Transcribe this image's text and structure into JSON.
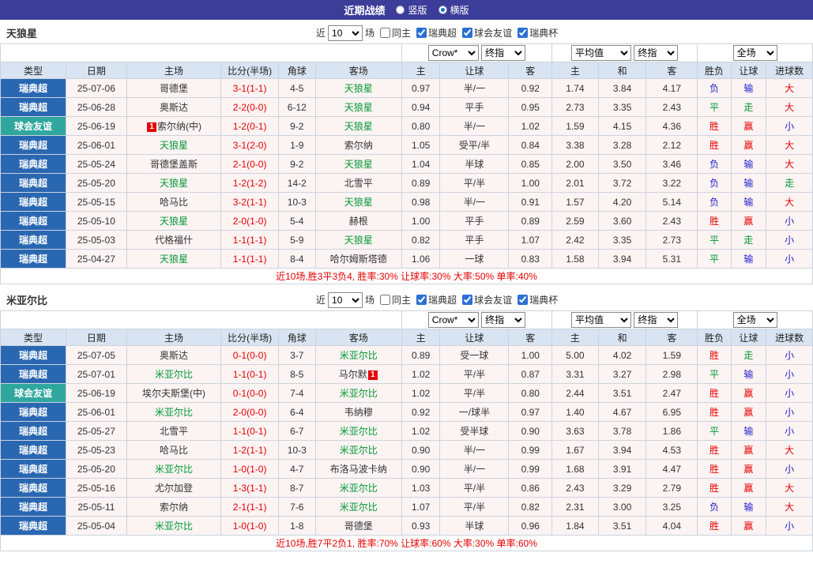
{
  "topbar": {
    "title": "近期战绩",
    "options": [
      {
        "label": "竖版",
        "selected": false
      },
      {
        "label": "横版",
        "selected": true
      }
    ]
  },
  "colors": {
    "league_badge": "#2a67b1",
    "friendly_badge": "#2fa79f",
    "win_red": "#e60000",
    "draw_green": "#009933",
    "loss_blue": "#2222cc"
  },
  "sections": [
    {
      "team": "天狼星",
      "filter": {
        "near_label": "近",
        "count": "10",
        "games_label": "场",
        "checkboxes": [
          {
            "label": "同主",
            "checked": false
          },
          {
            "label": "瑞典超",
            "checked": true
          },
          {
            "label": "球会友谊",
            "checked": true
          },
          {
            "label": "瑞典杯",
            "checked": true
          }
        ]
      },
      "selects": {
        "bookmaker": "Crow*",
        "bookmaker_stage": "终指",
        "euro": "平均值",
        "euro_stage": "终指",
        "scope": "全场"
      },
      "columns": [
        "类型",
        "日期",
        "主场",
        "比分(半场)",
        "角球",
        "客场",
        "主",
        "让球",
        "客",
        "主",
        "和",
        "客",
        "胜负",
        "让球",
        "进球数"
      ],
      "rows": [
        {
          "type": "瑞典超",
          "date": "25-07-06",
          "home": {
            "name": "哥德堡"
          },
          "score": "3-1(1-1)",
          "corner": "4-5",
          "away": {
            "name": "天狼星",
            "focus": true
          },
          "asia": [
            "0.97",
            "半/一",
            "0.92"
          ],
          "euro": [
            "1.74",
            "3.84",
            "4.17"
          ],
          "results": [
            "负",
            "输",
            "大"
          ]
        },
        {
          "type": "瑞典超",
          "date": "25-06-28",
          "home": {
            "name": "奥斯达"
          },
          "score": "2-2(0-0)",
          "corner": "6-12",
          "away": {
            "name": "天狼星",
            "focus": true
          },
          "asia": [
            "0.94",
            "平手",
            "0.95"
          ],
          "euro": [
            "2.73",
            "3.35",
            "2.43"
          ],
          "results": [
            "平",
            "走",
            "大"
          ]
        },
        {
          "type": "球会友谊",
          "date": "25-06-19",
          "home": {
            "name": "索尔纳(中)",
            "badge": "1",
            "badge_pos": "before"
          },
          "score": "1-2(0-1)",
          "corner": "9-2",
          "away": {
            "name": "天狼星",
            "focus": true
          },
          "asia": [
            "0.80",
            "半/一",
            "1.02"
          ],
          "euro": [
            "1.59",
            "4.15",
            "4.36"
          ],
          "results": [
            "胜",
            "赢",
            "小"
          ]
        },
        {
          "type": "瑞典超",
          "date": "25-06-01",
          "home": {
            "name": "天狼星",
            "focus": true
          },
          "score": "3-1(2-0)",
          "corner": "1-9",
          "away": {
            "name": "索尔纳"
          },
          "asia": [
            "1.05",
            "受平/半",
            "0.84"
          ],
          "euro": [
            "3.38",
            "3.28",
            "2.12"
          ],
          "results": [
            "胜",
            "赢",
            "大"
          ]
        },
        {
          "type": "瑞典超",
          "date": "25-05-24",
          "home": {
            "name": "哥德堡盖斯"
          },
          "score": "2-1(0-0)",
          "corner": "9-2",
          "away": {
            "name": "天狼星",
            "focus": true
          },
          "asia": [
            "1.04",
            "半球",
            "0.85"
          ],
          "euro": [
            "2.00",
            "3.50",
            "3.46"
          ],
          "results": [
            "负",
            "输",
            "大"
          ]
        },
        {
          "type": "瑞典超",
          "date": "25-05-20",
          "home": {
            "name": "天狼星",
            "focus": true
          },
          "score": "1-2(1-2)",
          "corner": "14-2",
          "away": {
            "name": "北雪平"
          },
          "asia": [
            "0.89",
            "平/半",
            "1.00"
          ],
          "euro": [
            "2.01",
            "3.72",
            "3.22"
          ],
          "results": [
            "负",
            "输",
            "走"
          ]
        },
        {
          "type": "瑞典超",
          "date": "25-05-15",
          "home": {
            "name": "哈马比"
          },
          "score": "3-2(1-1)",
          "corner": "10-3",
          "away": {
            "name": "天狼星",
            "focus": true
          },
          "asia": [
            "0.98",
            "半/一",
            "0.91"
          ],
          "euro": [
            "1.57",
            "4.20",
            "5.14"
          ],
          "results": [
            "负",
            "输",
            "大"
          ]
        },
        {
          "type": "瑞典超",
          "date": "25-05-10",
          "home": {
            "name": "天狼星",
            "focus": true
          },
          "score": "2-0(1-0)",
          "corner": "5-4",
          "away": {
            "name": "赫根"
          },
          "asia": [
            "1.00",
            "平手",
            "0.89"
          ],
          "euro": [
            "2.59",
            "3.60",
            "2.43"
          ],
          "results": [
            "胜",
            "赢",
            "小"
          ]
        },
        {
          "type": "瑞典超",
          "date": "25-05-03",
          "home": {
            "name": "代格福什"
          },
          "score": "1-1(1-1)",
          "corner": "5-9",
          "away": {
            "name": "天狼星",
            "focus": true
          },
          "asia": [
            "0.82",
            "平手",
            "1.07"
          ],
          "euro": [
            "2.42",
            "3.35",
            "2.73"
          ],
          "results": [
            "平",
            "走",
            "小"
          ]
        },
        {
          "type": "瑞典超",
          "date": "25-04-27",
          "home": {
            "name": "天狼星",
            "focus": true
          },
          "score": "1-1(1-1)",
          "corner": "8-4",
          "away": {
            "name": "哈尔姆斯塔德"
          },
          "asia": [
            "1.06",
            "一球",
            "0.83"
          ],
          "euro": [
            "1.58",
            "3.94",
            "5.31"
          ],
          "results": [
            "平",
            "输",
            "小"
          ]
        }
      ],
      "summary": "近10场,胜3平3负4, 胜率:30% 让球率:30% 大率:50% 单率:40%"
    },
    {
      "team": "米亚尔比",
      "filter": {
        "near_label": "近",
        "count": "10",
        "games_label": "场",
        "checkboxes": [
          {
            "label": "同主",
            "checked": false
          },
          {
            "label": "瑞典超",
            "checked": true
          },
          {
            "label": "球会友谊",
            "checked": true
          },
          {
            "label": "瑞典杯",
            "checked": true
          }
        ]
      },
      "selects": {
        "bookmaker": "Crow*",
        "bookmaker_stage": "终指",
        "euro": "平均值",
        "euro_stage": "终指",
        "scope": "全场"
      },
      "columns": [
        "类型",
        "日期",
        "主场",
        "比分(半场)",
        "角球",
        "客场",
        "主",
        "让球",
        "客",
        "主",
        "和",
        "客",
        "胜负",
        "让球",
        "进球数"
      ],
      "rows": [
        {
          "type": "瑞典超",
          "date": "25-07-05",
          "home": {
            "name": "奥斯达"
          },
          "score": "0-1(0-0)",
          "corner": "3-7",
          "away": {
            "name": "米亚尔比",
            "focus": true
          },
          "asia": [
            "0.89",
            "受一球",
            "1.00"
          ],
          "euro": [
            "5.00",
            "4.02",
            "1.59"
          ],
          "results": [
            "胜",
            "走",
            "小"
          ]
        },
        {
          "type": "瑞典超",
          "date": "25-07-01",
          "home": {
            "name": "米亚尔比",
            "focus": true
          },
          "score": "1-1(0-1)",
          "corner": "8-5",
          "away": {
            "name": "马尔默",
            "badge": "1",
            "badge_pos": "after"
          },
          "asia": [
            "1.02",
            "平/半",
            "0.87"
          ],
          "euro": [
            "3.31",
            "3.27",
            "2.98"
          ],
          "results": [
            "平",
            "输",
            "小"
          ]
        },
        {
          "type": "球会友谊",
          "date": "25-06-19",
          "home": {
            "name": "埃尔夫斯堡(中)"
          },
          "score": "0-1(0-0)",
          "corner": "7-4",
          "away": {
            "name": "米亚尔比",
            "focus": true
          },
          "asia": [
            "1.02",
            "平/半",
            "0.80"
          ],
          "euro": [
            "2.44",
            "3.51",
            "2.47"
          ],
          "results": [
            "胜",
            "赢",
            "小"
          ]
        },
        {
          "type": "瑞典超",
          "date": "25-06-01",
          "home": {
            "name": "米亚尔比",
            "focus": true
          },
          "score": "2-0(0-0)",
          "corner": "6-4",
          "away": {
            "name": "韦纳穆"
          },
          "asia": [
            "0.92",
            "一/球半",
            "0.97"
          ],
          "euro": [
            "1.40",
            "4.67",
            "6.95"
          ],
          "results": [
            "胜",
            "赢",
            "小"
          ]
        },
        {
          "type": "瑞典超",
          "date": "25-05-27",
          "home": {
            "name": "北雪平"
          },
          "score": "1-1(0-1)",
          "corner": "6-7",
          "away": {
            "name": "米亚尔比",
            "focus": true
          },
          "asia": [
            "1.02",
            "受半球",
            "0.90"
          ],
          "euro": [
            "3.63",
            "3.78",
            "1.86"
          ],
          "results": [
            "平",
            "输",
            "小"
          ]
        },
        {
          "type": "瑞典超",
          "date": "25-05-23",
          "home": {
            "name": "哈马比"
          },
          "score": "1-2(1-1)",
          "corner": "10-3",
          "away": {
            "name": "米亚尔比",
            "focus": true
          },
          "asia": [
            "0.90",
            "半/一",
            "0.99"
          ],
          "euro": [
            "1.67",
            "3.94",
            "4.53"
          ],
          "results": [
            "胜",
            "赢",
            "大"
          ]
        },
        {
          "type": "瑞典超",
          "date": "25-05-20",
          "home": {
            "name": "米亚尔比",
            "focus": true
          },
          "score": "1-0(1-0)",
          "corner": "4-7",
          "away": {
            "name": "布洛马波卡纳"
          },
          "asia": [
            "0.90",
            "半/一",
            "0.99"
          ],
          "euro": [
            "1.68",
            "3.91",
            "4.47"
          ],
          "results": [
            "胜",
            "赢",
            "小"
          ]
        },
        {
          "type": "瑞典超",
          "date": "25-05-16",
          "home": {
            "name": "尤尔加登"
          },
          "score": "1-3(1-1)",
          "corner": "8-7",
          "away": {
            "name": "米亚尔比",
            "focus": true
          },
          "asia": [
            "1.03",
            "平/半",
            "0.86"
          ],
          "euro": [
            "2.43",
            "3.29",
            "2.79"
          ],
          "results": [
            "胜",
            "赢",
            "大"
          ]
        },
        {
          "type": "瑞典超",
          "date": "25-05-11",
          "home": {
            "name": "索尔纳"
          },
          "score": "2-1(1-1)",
          "corner": "7-6",
          "away": {
            "name": "米亚尔比",
            "focus": true
          },
          "asia": [
            "1.07",
            "平/半",
            "0.82"
          ],
          "euro": [
            "2.31",
            "3.00",
            "3.25"
          ],
          "results": [
            "负",
            "输",
            "大"
          ]
        },
        {
          "type": "瑞典超",
          "date": "25-05-04",
          "home": {
            "name": "米亚尔比",
            "focus": true
          },
          "score": "1-0(1-0)",
          "corner": "1-8",
          "away": {
            "name": "哥德堡"
          },
          "asia": [
            "0.93",
            "半球",
            "0.96"
          ],
          "euro": [
            "1.84",
            "3.51",
            "4.04"
          ],
          "results": [
            "胜",
            "赢",
            "小"
          ]
        }
      ],
      "summary": "近10场,胜7平2负1, 胜率:70% 让球率:60% 大率:30% 单率:60%"
    }
  ]
}
